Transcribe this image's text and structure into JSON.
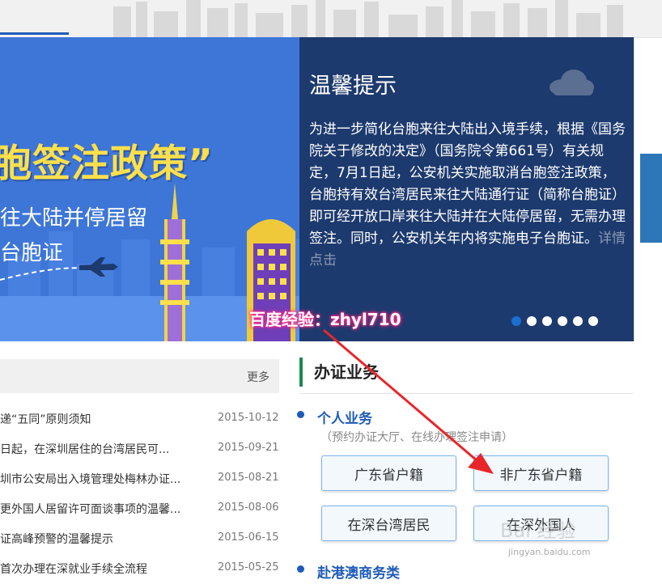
{
  "banner": {
    "title": "胞签注政策”",
    "sub1": "往大陆并停居留",
    "sub2": "台胞证"
  },
  "notice": {
    "title": "温馨提示",
    "body": "为进一步简化台胞来往大陆出入境手续，根据《国务院关于修改的决定》（国务院令第661号）有关规定，7月1日起，公安机关实施取消台胞签注政策，台胞持有效台湾居民来往大陆通行证（简称台胞证）即可经开放口岸来往大陆并在大陆停居留，无需办理签注。同时，公安机关年内将实施电子台胞证。",
    "more": "详情点击",
    "carousel_count": 6,
    "carousel_active": 1
  },
  "news": {
    "more": "更多",
    "items": [
      {
        "title": "递“五同”原则须知",
        "date": "2015-10-12"
      },
      {
        "title": "日起，在深圳居住的台湾居民可...",
        "date": "2015-09-21"
      },
      {
        "title": "圳市公安局出入境管理处梅林办证...",
        "date": "2015-08-21"
      },
      {
        "title": "更外国人居留许可面谈事项的温馨...",
        "date": "2015-08-06"
      },
      {
        "title": "证高峰预警的温馨提示",
        "date": "2015-06-15"
      },
      {
        "title": "首次办理在深就业手续全流程",
        "date": "2015-05-25"
      }
    ]
  },
  "services": {
    "title": "办证业务",
    "personal": {
      "label": "个人业务",
      "sub": "（预约办证大厅、在线办理签注申请）",
      "buttons": [
        "广东省户籍",
        "非广东省户籍",
        "在深台湾居民",
        "在深外国人"
      ]
    },
    "hkmo": {
      "label": "赴港澳商务类"
    }
  },
  "annotation": {
    "watermark": "百度经验：zhyl710",
    "corner": "Bai 经验",
    "corner_url": "jingyan.baidu.com",
    "arrow_color": "#e8262a"
  }
}
